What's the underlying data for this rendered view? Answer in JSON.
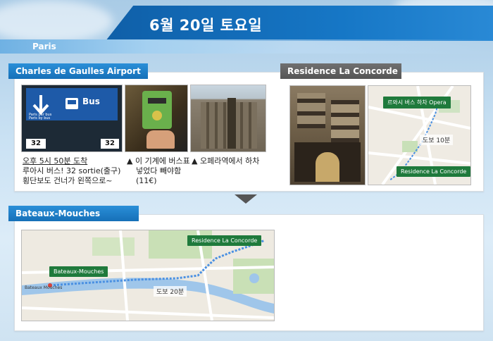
{
  "header": {
    "date_title": "6월 20일 토요일",
    "city": "Paris"
  },
  "airport": {
    "tab": "Charles de Gaulles Airport",
    "sign_bus": "Bus",
    "sign_paris_bus": "Paris par bus\nParis by bus",
    "sign_number": "32",
    "caption1_title": "오후 5시 50분 도착",
    "caption1_line2": "루아시 버스!  32 sortie(출구)",
    "caption1_line3": "횡단보도 건너가 왼쪽으로~",
    "caption2_line1": "▲ 이 기계에 버스표",
    "caption2_line2": "넣었다 빼야함",
    "caption2_line3": "(11€)",
    "caption3": "▲ 오페라역에서 하차"
  },
  "residence": {
    "tab": "Residence La Concorde",
    "map_label_top": "르와시 버스 하차 Opera",
    "map_note": "도보 10분",
    "map_label_bottom": "Residence La Concorde"
  },
  "bateaux": {
    "tab": "Bateaux-Mouches",
    "map_label_left": "Bateaux-Mouches",
    "map_label_right": "Residence La Concorde",
    "map_note": "도보 20분",
    "map_small_label": "Bateaux Mouches"
  }
}
